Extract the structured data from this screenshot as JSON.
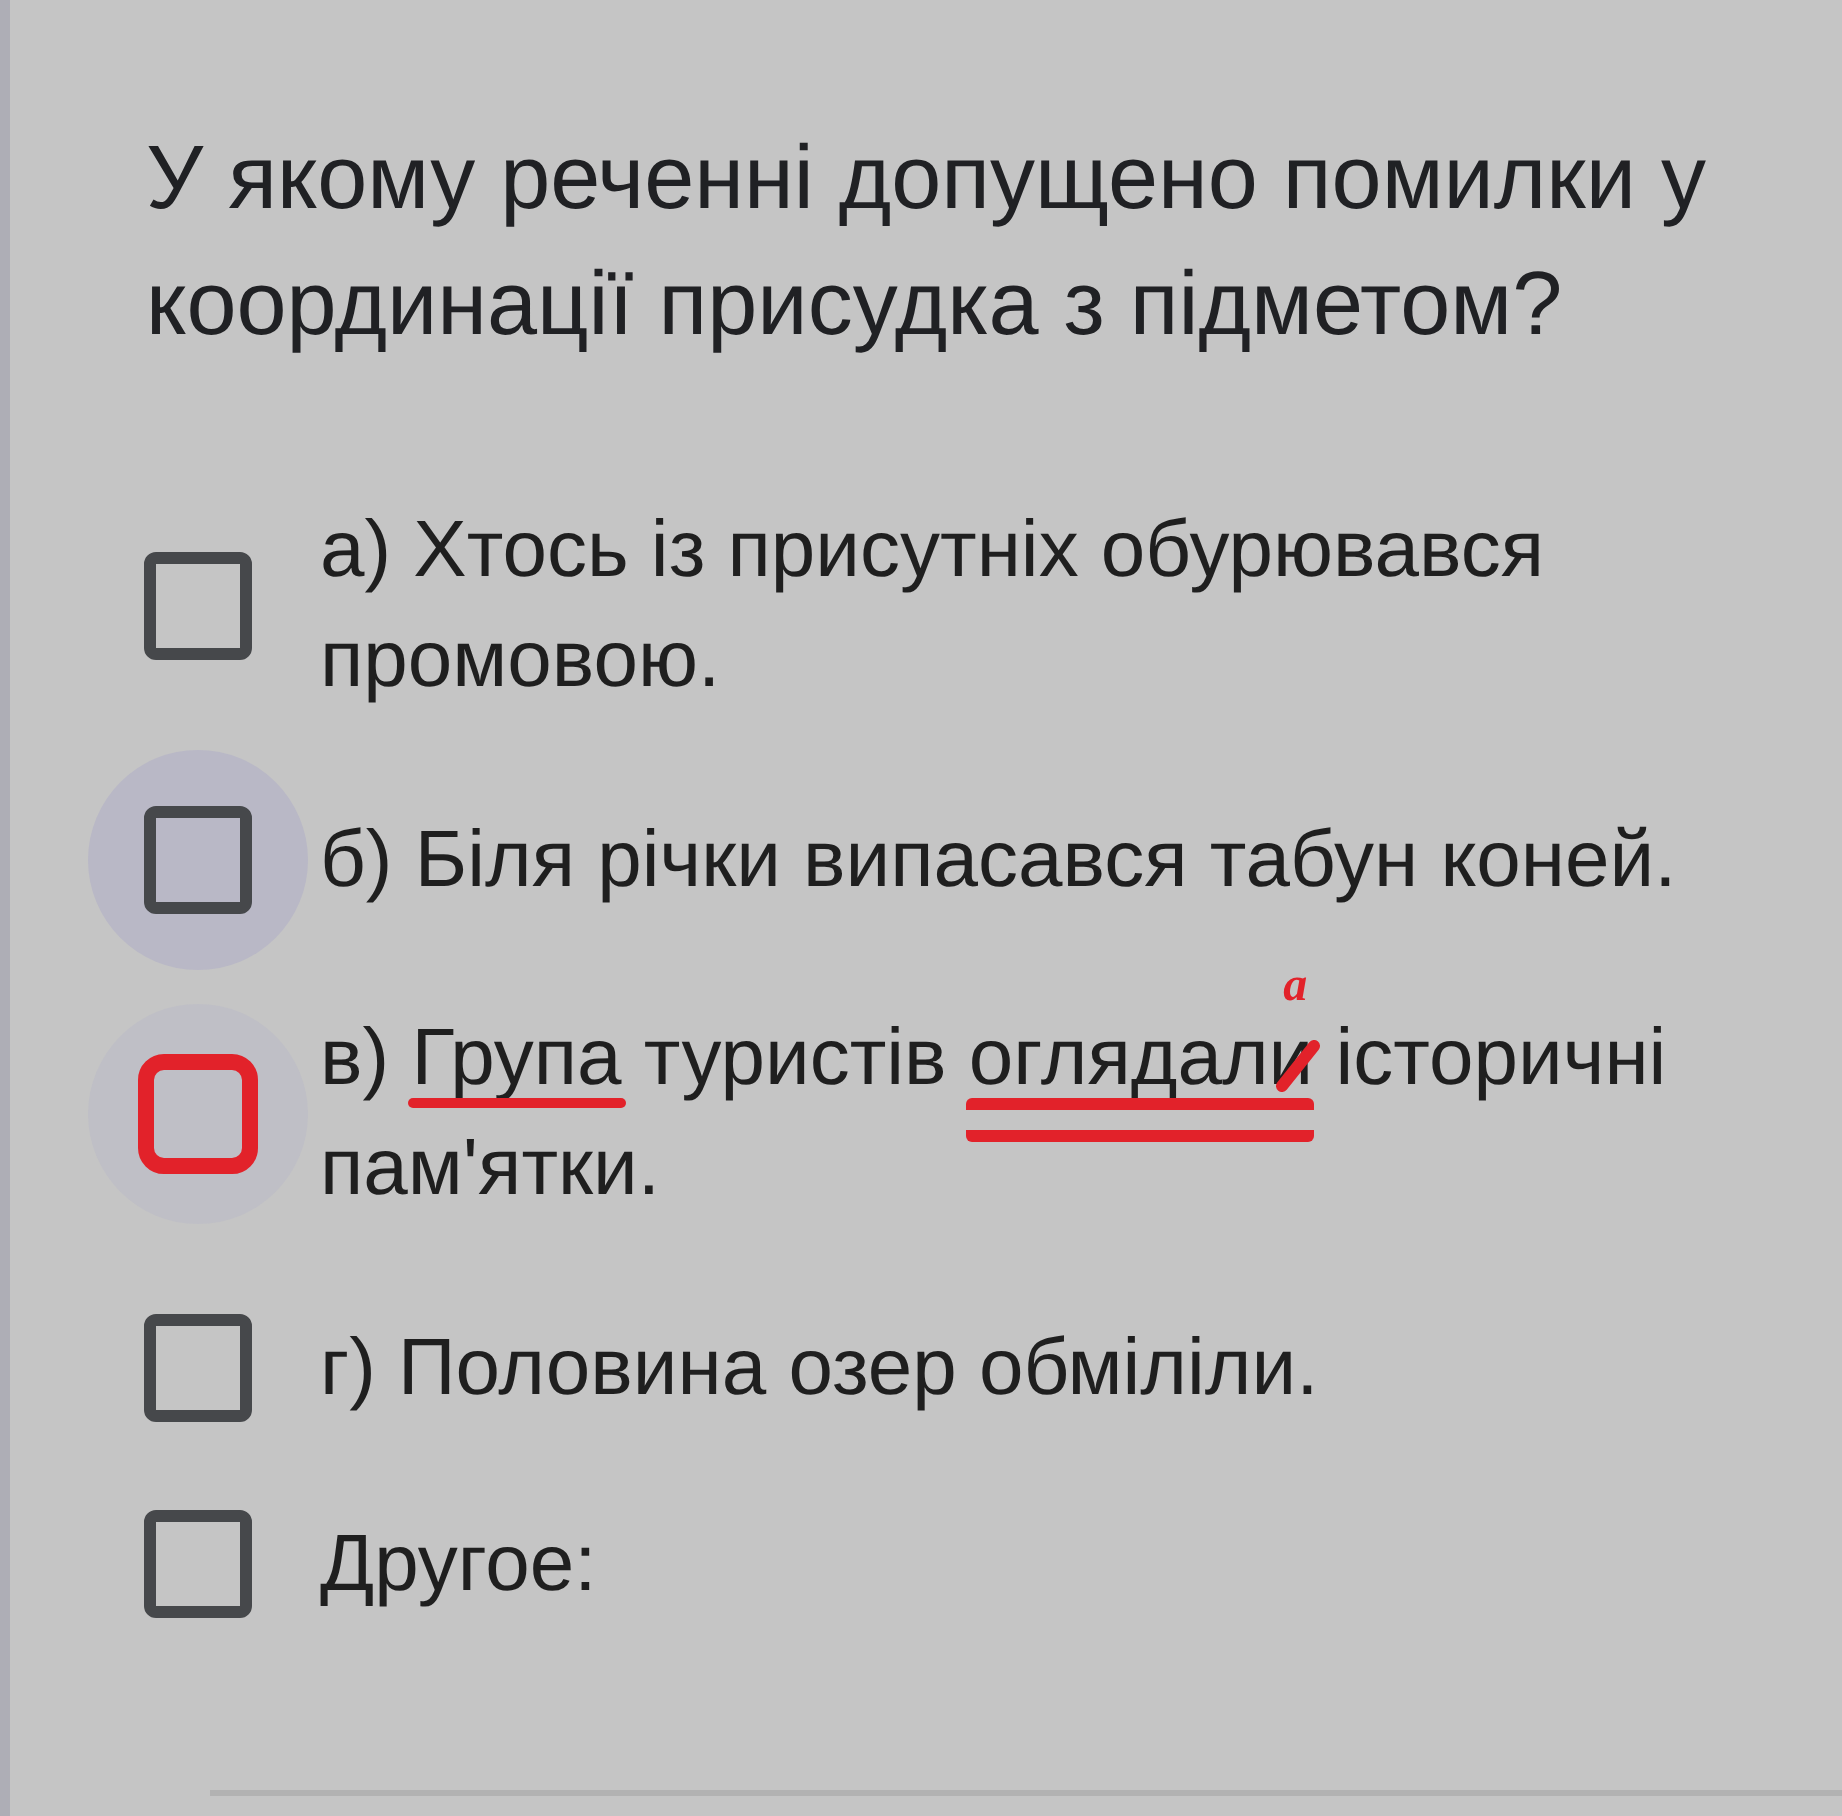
{
  "question": {
    "text": "У якому реченні допущено помилки у координації присудка з підметом?"
  },
  "options": [
    {
      "kind": "choice",
      "segments": [
        {
          "kind": "plain",
          "text": "а) Хтось із присутніх обурювався промовою."
        }
      ],
      "checked": false,
      "focused": false,
      "hovered": false,
      "marked": false
    },
    {
      "kind": "choice",
      "segments": [
        {
          "kind": "plain",
          "text": "б) Біля річки випасався табун коней."
        }
      ],
      "checked": false,
      "focused": true,
      "hovered": false,
      "marked": false
    },
    {
      "kind": "choice",
      "segments": [
        {
          "kind": "plain",
          "text": "в) "
        },
        {
          "kind": "underlined",
          "text": "Група"
        },
        {
          "kind": "plain",
          "text": " туристів "
        },
        {
          "kind": "double-underlined",
          "text": "оглядали",
          "correction": "а"
        },
        {
          "kind": "plain",
          "text": " історичні пам'ятки."
        }
      ],
      "checked": false,
      "focused": false,
      "hovered": true,
      "marked": true
    },
    {
      "kind": "choice",
      "segments": [
        {
          "kind": "plain",
          "text": "г) Половина озер обміліли."
        }
      ],
      "checked": false,
      "focused": false,
      "hovered": false,
      "marked": false
    },
    {
      "kind": "other",
      "segments": [
        {
          "kind": "plain",
          "text": "Другое:"
        }
      ],
      "checked": false,
      "focused": false,
      "hovered": false,
      "marked": false
    }
  ]
}
